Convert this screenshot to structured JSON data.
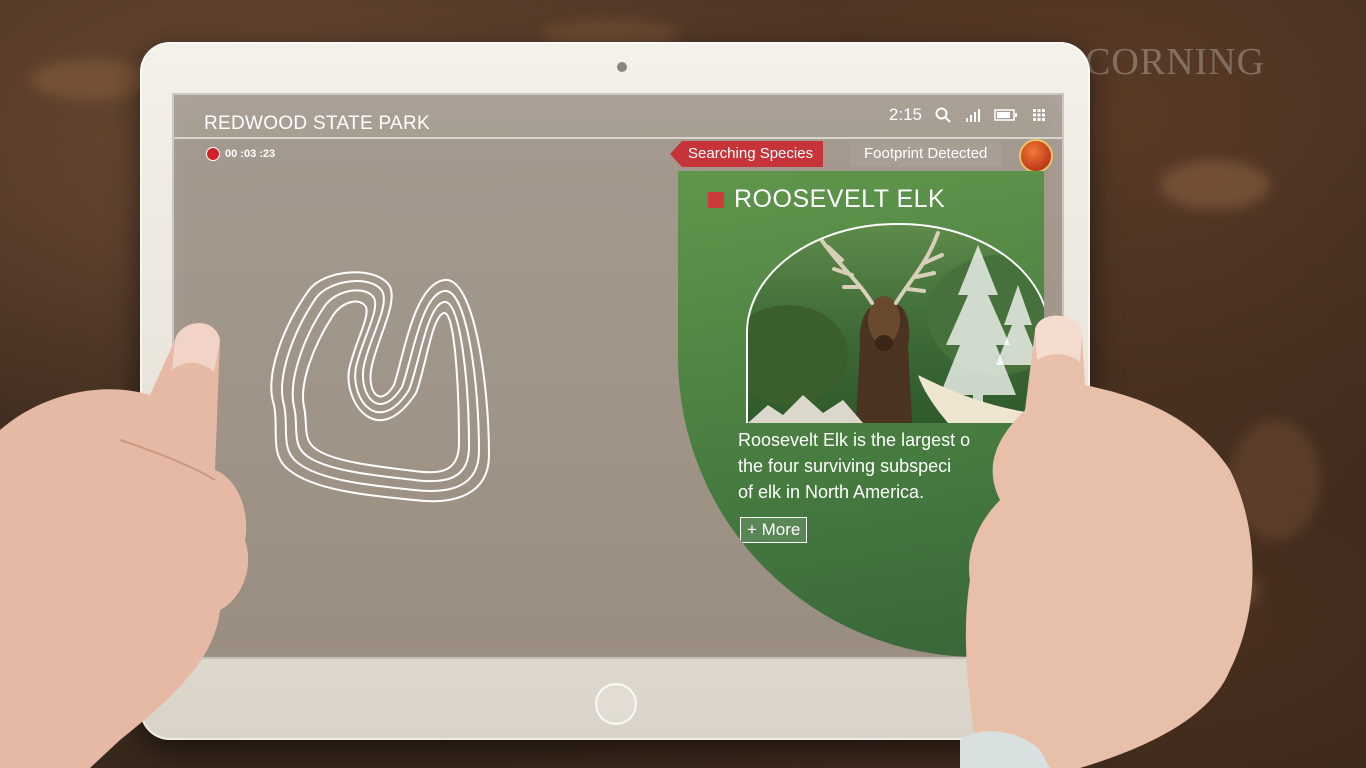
{
  "watermark": "CORNING",
  "screen": {
    "title": "REDWOOD STATE PARK",
    "time": "2:15",
    "recording_timer": "00 :03 :23",
    "status_icons": [
      "search-icon",
      "signal-icon",
      "battery-icon",
      "grid-menu-icon"
    ]
  },
  "species_panel": {
    "search_pill": "Searching Species",
    "detected_label": "Footprint Detected",
    "species_name": "ROOSEVELT ELK",
    "description_lines": [
      "Roosevelt Elk is the largest o",
      "the four surviving subspeci",
      "of elk in North America."
    ],
    "more_button": "+ More"
  },
  "colors": {
    "accent_red": "#c6343a",
    "panel_green": "#5a9646",
    "recording_red": "#d2202a"
  }
}
